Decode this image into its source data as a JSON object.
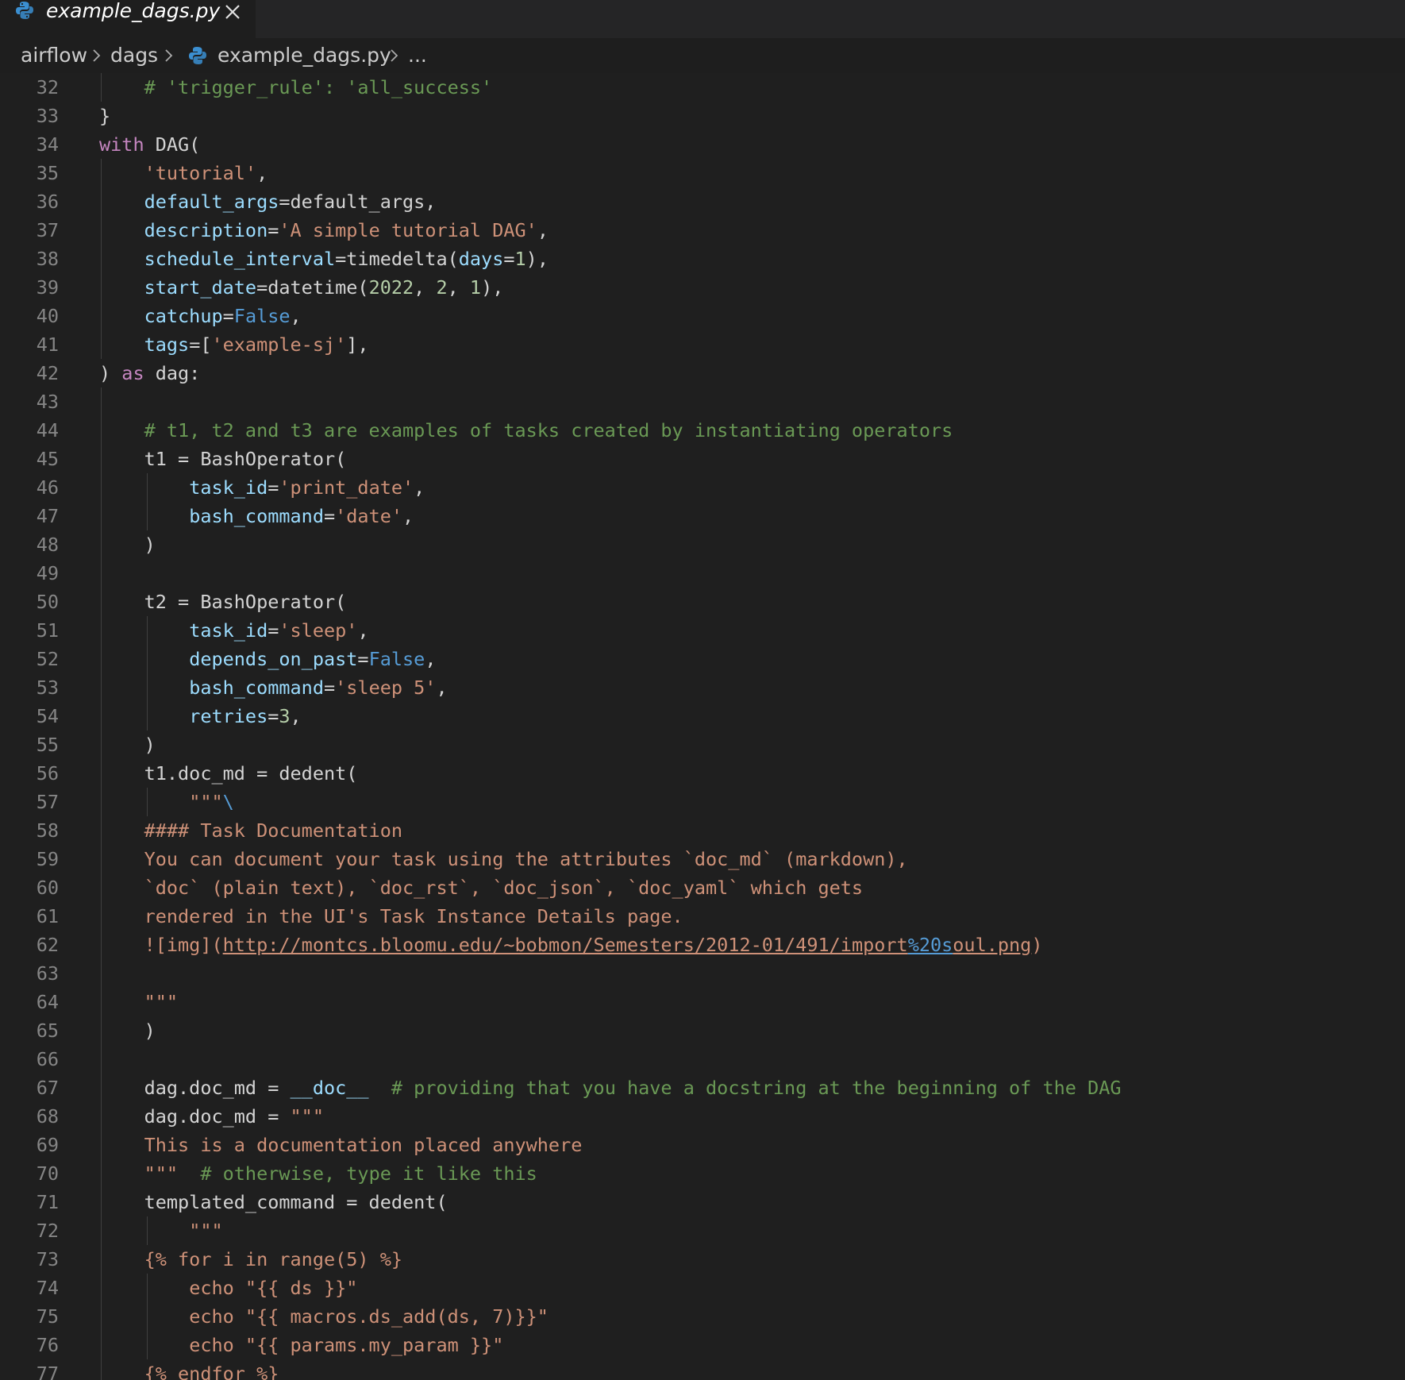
{
  "tab": {
    "title": "example_dags.py",
    "close_icon": "close-icon",
    "file_icon": "python-icon"
  },
  "breadcrumb": {
    "items": [
      "airflow",
      "dags",
      "example_dags.py",
      "..."
    ]
  },
  "colors": {
    "keyword": "#c586c0",
    "string": "#ce9178",
    "comment": "#6a9955",
    "parameter": "#9cdcfe",
    "number": "#b5cea8",
    "constant": "#569cd6",
    "line_number": "#858585",
    "background": "#1f1f1f"
  },
  "lines": [
    {
      "n": "32",
      "tokens": [
        {
          "t": "    "
        },
        {
          "t": "# 'trigger_rule': 'all_success'",
          "c": "cmt"
        }
      ]
    },
    {
      "n": "33",
      "tokens": [
        {
          "t": "}"
        }
      ]
    },
    {
      "n": "34",
      "tokens": [
        {
          "t": "with",
          "c": "kw"
        },
        {
          "t": " DAG("
        }
      ]
    },
    {
      "n": "35",
      "tokens": [
        {
          "t": "    "
        },
        {
          "t": "'tutorial'",
          "c": "str"
        },
        {
          "t": ","
        }
      ]
    },
    {
      "n": "36",
      "tokens": [
        {
          "t": "    "
        },
        {
          "t": "default_args",
          "c": "param"
        },
        {
          "t": "=default_args,"
        }
      ]
    },
    {
      "n": "37",
      "tokens": [
        {
          "t": "    "
        },
        {
          "t": "description",
          "c": "param"
        },
        {
          "t": "="
        },
        {
          "t": "'A simple tutorial DAG'",
          "c": "str"
        },
        {
          "t": ","
        }
      ]
    },
    {
      "n": "38",
      "tokens": [
        {
          "t": "    "
        },
        {
          "t": "schedule_interval",
          "c": "param"
        },
        {
          "t": "=timedelta("
        },
        {
          "t": "days",
          "c": "param"
        },
        {
          "t": "="
        },
        {
          "t": "1",
          "c": "num"
        },
        {
          "t": "),"
        }
      ]
    },
    {
      "n": "39",
      "tokens": [
        {
          "t": "    "
        },
        {
          "t": "start_date",
          "c": "param"
        },
        {
          "t": "=datetime("
        },
        {
          "t": "2022",
          "c": "num"
        },
        {
          "t": ", "
        },
        {
          "t": "2",
          "c": "num"
        },
        {
          "t": ", "
        },
        {
          "t": "1",
          "c": "num"
        },
        {
          "t": "),"
        }
      ]
    },
    {
      "n": "40",
      "tokens": [
        {
          "t": "    "
        },
        {
          "t": "catchup",
          "c": "param"
        },
        {
          "t": "="
        },
        {
          "t": "False",
          "c": "const"
        },
        {
          "t": ","
        }
      ]
    },
    {
      "n": "41",
      "tokens": [
        {
          "t": "    "
        },
        {
          "t": "tags",
          "c": "param"
        },
        {
          "t": "=["
        },
        {
          "t": "'example-sj'",
          "c": "str"
        },
        {
          "t": "],"
        }
      ]
    },
    {
      "n": "42",
      "tokens": [
        {
          "t": ") "
        },
        {
          "t": "as",
          "c": "kw"
        },
        {
          "t": " dag:"
        }
      ]
    },
    {
      "n": "43",
      "tokens": []
    },
    {
      "n": "44",
      "tokens": [
        {
          "t": "    "
        },
        {
          "t": "# t1, t2 and t3 are examples of tasks created by instantiating operators",
          "c": "cmt"
        }
      ]
    },
    {
      "n": "45",
      "tokens": [
        {
          "t": "    t1 = BashOperator("
        }
      ]
    },
    {
      "n": "46",
      "tokens": [
        {
          "t": "        "
        },
        {
          "t": "task_id",
          "c": "param"
        },
        {
          "t": "="
        },
        {
          "t": "'print_date'",
          "c": "str"
        },
        {
          "t": ","
        }
      ]
    },
    {
      "n": "47",
      "tokens": [
        {
          "t": "        "
        },
        {
          "t": "bash_command",
          "c": "param"
        },
        {
          "t": "="
        },
        {
          "t": "'date'",
          "c": "str"
        },
        {
          "t": ","
        }
      ]
    },
    {
      "n": "48",
      "tokens": [
        {
          "t": "    )"
        }
      ]
    },
    {
      "n": "49",
      "tokens": []
    },
    {
      "n": "50",
      "tokens": [
        {
          "t": "    t2 = BashOperator("
        }
      ]
    },
    {
      "n": "51",
      "tokens": [
        {
          "t": "        "
        },
        {
          "t": "task_id",
          "c": "param"
        },
        {
          "t": "="
        },
        {
          "t": "'sleep'",
          "c": "str"
        },
        {
          "t": ","
        }
      ]
    },
    {
      "n": "52",
      "tokens": [
        {
          "t": "        "
        },
        {
          "t": "depends_on_past",
          "c": "param"
        },
        {
          "t": "="
        },
        {
          "t": "False",
          "c": "const"
        },
        {
          "t": ","
        }
      ]
    },
    {
      "n": "53",
      "tokens": [
        {
          "t": "        "
        },
        {
          "t": "bash_command",
          "c": "param"
        },
        {
          "t": "="
        },
        {
          "t": "'sleep 5'",
          "c": "str"
        },
        {
          "t": ","
        }
      ]
    },
    {
      "n": "54",
      "tokens": [
        {
          "t": "        "
        },
        {
          "t": "retries",
          "c": "param"
        },
        {
          "t": "="
        },
        {
          "t": "3",
          "c": "num"
        },
        {
          "t": ","
        }
      ]
    },
    {
      "n": "55",
      "tokens": [
        {
          "t": "    )"
        }
      ]
    },
    {
      "n": "56",
      "tokens": [
        {
          "t": "    t1.doc_md = dedent("
        }
      ]
    },
    {
      "n": "57",
      "tokens": [
        {
          "t": "        "
        },
        {
          "t": "\"\"\"",
          "c": "str"
        },
        {
          "t": "\\",
          "c": "esc"
        }
      ]
    },
    {
      "n": "58",
      "tokens": [
        {
          "t": "    "
        },
        {
          "t": "#### Task Documentation",
          "c": "str"
        }
      ]
    },
    {
      "n": "59",
      "tokens": [
        {
          "t": "    "
        },
        {
          "t": "You can document your task using the attributes `doc_md` (markdown),",
          "c": "str"
        }
      ]
    },
    {
      "n": "60",
      "tokens": [
        {
          "t": "    "
        },
        {
          "t": "`doc` (plain text), `doc_rst`, `doc_json`, `doc_yaml` which gets",
          "c": "str"
        }
      ]
    },
    {
      "n": "61",
      "tokens": [
        {
          "t": "    "
        },
        {
          "t": "rendered in the UI's Task Instance Details page.",
          "c": "str"
        }
      ]
    },
    {
      "n": "62",
      "tokens": [
        {
          "t": "    "
        },
        {
          "t": "![img](",
          "c": "str"
        },
        {
          "t": "http://montcs.bloomu.edu/~bobmon/Semesters/2012-01/491/import",
          "c": "url"
        },
        {
          "t": "%20s",
          "c": "url-esc"
        },
        {
          "t": "oul.png",
          "c": "url"
        },
        {
          "t": ")",
          "c": "str"
        }
      ]
    },
    {
      "n": "63",
      "tokens": []
    },
    {
      "n": "64",
      "tokens": [
        {
          "t": "    "
        },
        {
          "t": "\"\"\"",
          "c": "str"
        }
      ]
    },
    {
      "n": "65",
      "tokens": [
        {
          "t": "    )"
        }
      ]
    },
    {
      "n": "66",
      "tokens": []
    },
    {
      "n": "67",
      "tokens": [
        {
          "t": "    dag.doc_md = "
        },
        {
          "t": "__doc__",
          "c": "var"
        },
        {
          "t": "  "
        },
        {
          "t": "# providing that you have a docstring at the beginning of the DAG",
          "c": "cmt"
        }
      ]
    },
    {
      "n": "68",
      "tokens": [
        {
          "t": "    dag.doc_md = "
        },
        {
          "t": "\"\"\"",
          "c": "str"
        }
      ]
    },
    {
      "n": "69",
      "tokens": [
        {
          "t": "    "
        },
        {
          "t": "This is a documentation placed anywhere",
          "c": "str"
        }
      ]
    },
    {
      "n": "70",
      "tokens": [
        {
          "t": "    "
        },
        {
          "t": "\"\"\"",
          "c": "str"
        },
        {
          "t": "  "
        },
        {
          "t": "# otherwise, type it like this",
          "c": "cmt"
        }
      ]
    },
    {
      "n": "71",
      "tokens": [
        {
          "t": "    templated_command = dedent("
        }
      ]
    },
    {
      "n": "72",
      "tokens": [
        {
          "t": "        "
        },
        {
          "t": "\"\"\"",
          "c": "str"
        }
      ]
    },
    {
      "n": "73",
      "tokens": [
        {
          "t": "    "
        },
        {
          "t": "{% for i in range(5) %}",
          "c": "str"
        }
      ]
    },
    {
      "n": "74",
      "tokens": [
        {
          "t": "        "
        },
        {
          "t": "echo \"{{ ds }}\"",
          "c": "str"
        }
      ]
    },
    {
      "n": "75",
      "tokens": [
        {
          "t": "        "
        },
        {
          "t": "echo \"{{ macros.ds_add(ds, 7)}}\"",
          "c": "str"
        }
      ]
    },
    {
      "n": "76",
      "tokens": [
        {
          "t": "        "
        },
        {
          "t": "echo \"{{ params.my_param }}\"",
          "c": "str"
        }
      ]
    },
    {
      "n": "77",
      "tokens": [
        {
          "t": "    "
        },
        {
          "t": "{% endfor %}",
          "c": "str"
        }
      ]
    }
  ]
}
